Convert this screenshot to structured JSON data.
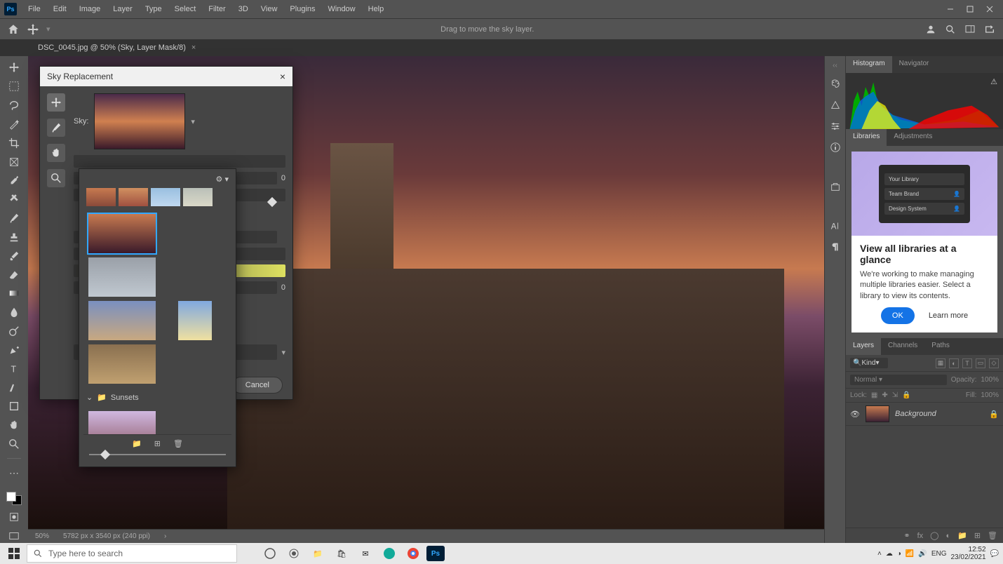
{
  "menu": {
    "items": [
      "File",
      "Edit",
      "Image",
      "Layer",
      "Type",
      "Select",
      "Filter",
      "3D",
      "View",
      "Plugins",
      "Window",
      "Help"
    ]
  },
  "options_hint": "Drag to move the sky layer.",
  "tab": "DSC_0045.jpg @ 50% (Sky, Layer Mask/8)",
  "status": {
    "zoom": "50%",
    "dims": "5782 px x 3540 px (240 ppi)"
  },
  "dialog": {
    "title": "Sky Replacement",
    "sky_label": "Sky:",
    "value_0": "0",
    "value_1": "0",
    "cancel": "Cancel",
    "folder": "Sunsets"
  },
  "panels": {
    "hist_tabs": [
      "Histogram",
      "Navigator"
    ],
    "lib_tabs": [
      "Libraries",
      "Adjustments"
    ],
    "layer_tabs": [
      "Layers",
      "Channels",
      "Paths"
    ],
    "lib_preview": {
      "r1": "Your Library",
      "r2": "Team Brand",
      "r3": "Design System"
    },
    "lib_title": "View all libraries at a glance",
    "lib_body": "We're working to make managing multiple libraries easier. Select a library to view its contents.",
    "lib_ok": "OK",
    "lib_learn": "Learn more",
    "kind": "Kind",
    "blend": "Normal",
    "opacity_lbl": "Opacity:",
    "opacity_val": "100%",
    "lock_lbl": "Lock:",
    "fill_lbl": "Fill:",
    "fill_val": "100%",
    "layer_name": "Background"
  },
  "taskbar": {
    "search_placeholder": "Type here to search",
    "lang": "ENG",
    "time": "12:52",
    "date": "23/02/2021"
  }
}
